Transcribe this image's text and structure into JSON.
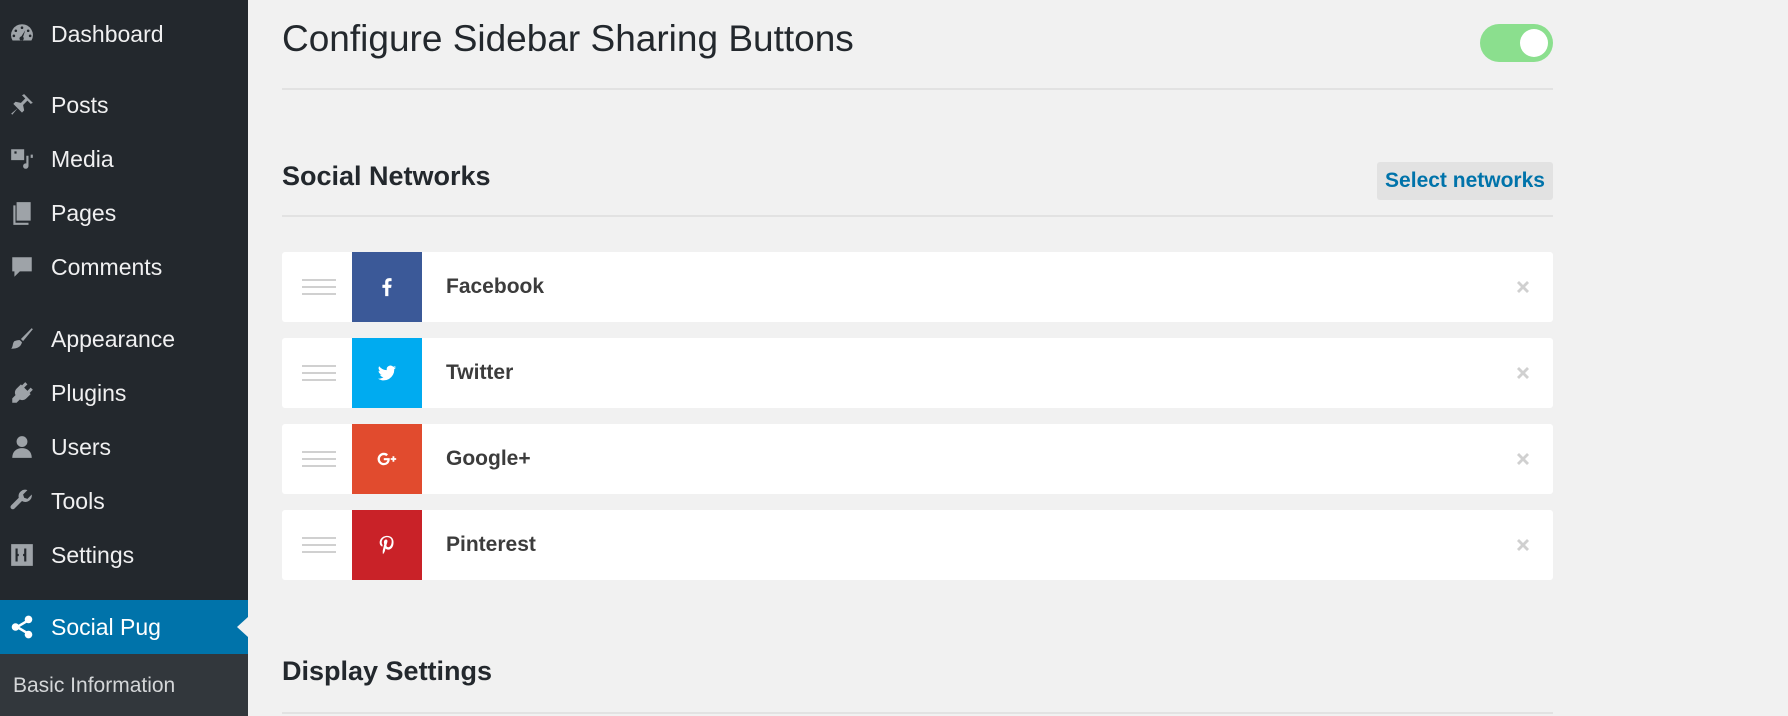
{
  "sidebar": {
    "items": [
      {
        "label": "Dashboard",
        "icon": "dashboard-icon"
      },
      {
        "label": "Posts",
        "icon": "pushpin-icon"
      },
      {
        "label": "Media",
        "icon": "media-icon"
      },
      {
        "label": "Pages",
        "icon": "pages-icon"
      },
      {
        "label": "Comments",
        "icon": "comment-icon"
      },
      {
        "label": "Appearance",
        "icon": "paintbrush-icon"
      },
      {
        "label": "Plugins",
        "icon": "plugin-icon"
      },
      {
        "label": "Users",
        "icon": "user-icon"
      },
      {
        "label": "Tools",
        "icon": "wrench-icon"
      },
      {
        "label": "Settings",
        "icon": "settings-icon"
      },
      {
        "label": "Social Pug",
        "icon": "share-icon",
        "active": true
      }
    ],
    "submenu": {
      "label": "Basic Information"
    }
  },
  "header": {
    "title": "Configure Sidebar Sharing Buttons",
    "toggle_enabled": true
  },
  "social_networks": {
    "title": "Social Networks",
    "select_button": "Select networks",
    "networks": [
      {
        "name": "Facebook",
        "icon": "facebook-icon",
        "color": "#3b5998"
      },
      {
        "name": "Twitter",
        "icon": "twitter-icon",
        "color": "#00abf0"
      },
      {
        "name": "Google+",
        "icon": "google-plus-icon",
        "color": "#e14b2e"
      },
      {
        "name": "Pinterest",
        "icon": "pinterest-icon",
        "color": "#c92228"
      }
    ]
  },
  "display_settings": {
    "title": "Display Settings"
  },
  "colors": {
    "sidebar_bg": "#23282d",
    "active_bg": "#0073aa",
    "toggle_on": "#8bdf8e",
    "link": "#0073aa"
  }
}
